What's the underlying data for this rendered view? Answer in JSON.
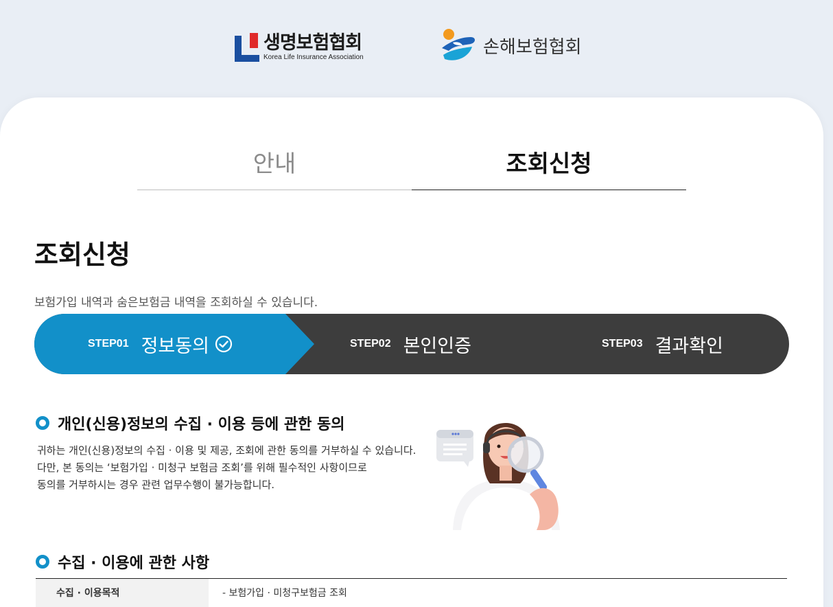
{
  "header": {
    "life_logo_ko": "생명보험협회",
    "life_logo_en": "Korea Life Insurance Association",
    "nonlife_logo_ko": "손해보험협회"
  },
  "tabs": [
    {
      "label": "안내",
      "active": false
    },
    {
      "label": "조회신청",
      "active": true
    }
  ],
  "page": {
    "title": "조회신청",
    "description": "보험가입 내역과 숨은보험금 내역을 조회하실 수 있습니다."
  },
  "steps": [
    {
      "no": "STEP01",
      "label": "정보동의",
      "active": true
    },
    {
      "no": "STEP02",
      "label": "본인인증",
      "active": false
    },
    {
      "no": "STEP03",
      "label": "결과확인",
      "active": false
    }
  ],
  "section1": {
    "title": "개인(신용)정보의 수집 · 이용 등에 관한 동의",
    "lines": [
      "귀하는 개인(신용)정보의 수집 · 이용 및 제공, 조회에 관한 동의를 거부하실 수 있습니다.",
      "다만, 본 동의는 ‘보험가입 · 미청구 보험금 조회’를 위해 필수적인 사항이므로",
      "동의를 거부하시는 경우 관련 업무수행이 불가능합니다."
    ]
  },
  "section2": {
    "title": "수집 · 이용에 관한 사항",
    "table": [
      {
        "header": "수집 · 이용목적",
        "value": "- 보험가입 · 미청구보험금 조회"
      }
    ]
  },
  "colors": {
    "accent": "#1290c9",
    "step_bar": "#3d3d3d",
    "background": "#e9eef5"
  }
}
